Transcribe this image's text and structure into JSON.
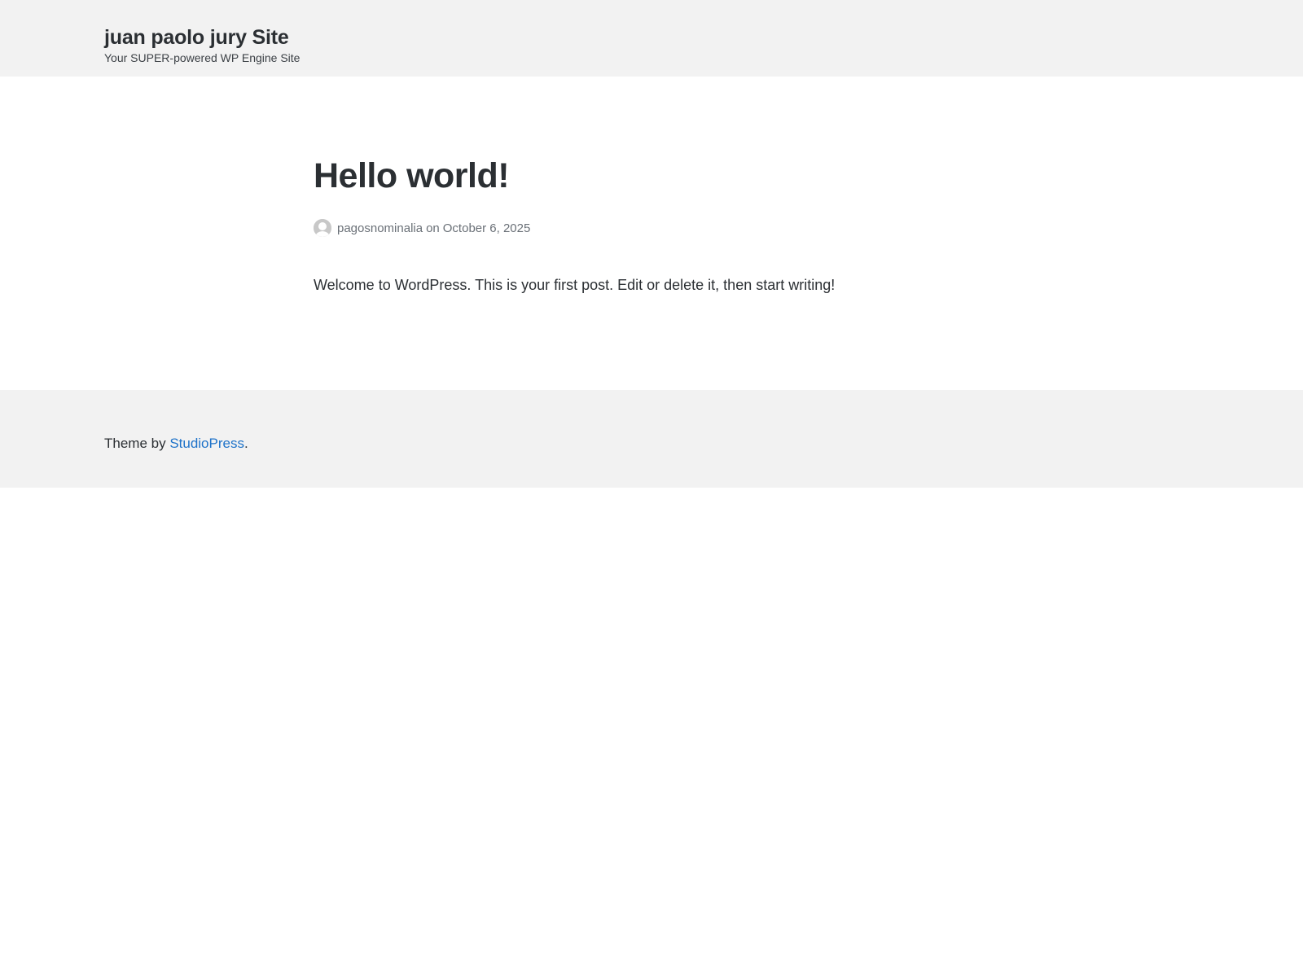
{
  "header": {
    "site_title": "juan paolo jury Site",
    "tagline": "Your SUPER-powered WP Engine Site"
  },
  "post": {
    "title": "Hello world!",
    "author": "pagosnominalia",
    "on": "on",
    "date": "October 6, 2025",
    "content": "Welcome to WordPress. This is your first post. Edit or delete it, then start writing!"
  },
  "footer": {
    "prefix": "Theme by ",
    "link_text": "StudioPress",
    "suffix": "."
  },
  "icons": {
    "avatar": "user-avatar-icon"
  },
  "colors": {
    "background": "#ffffff",
    "header_footer_bg": "#f2f2f2",
    "text": "#2b2f33",
    "meta_text": "#6a7077",
    "link": "#1f73c9"
  }
}
